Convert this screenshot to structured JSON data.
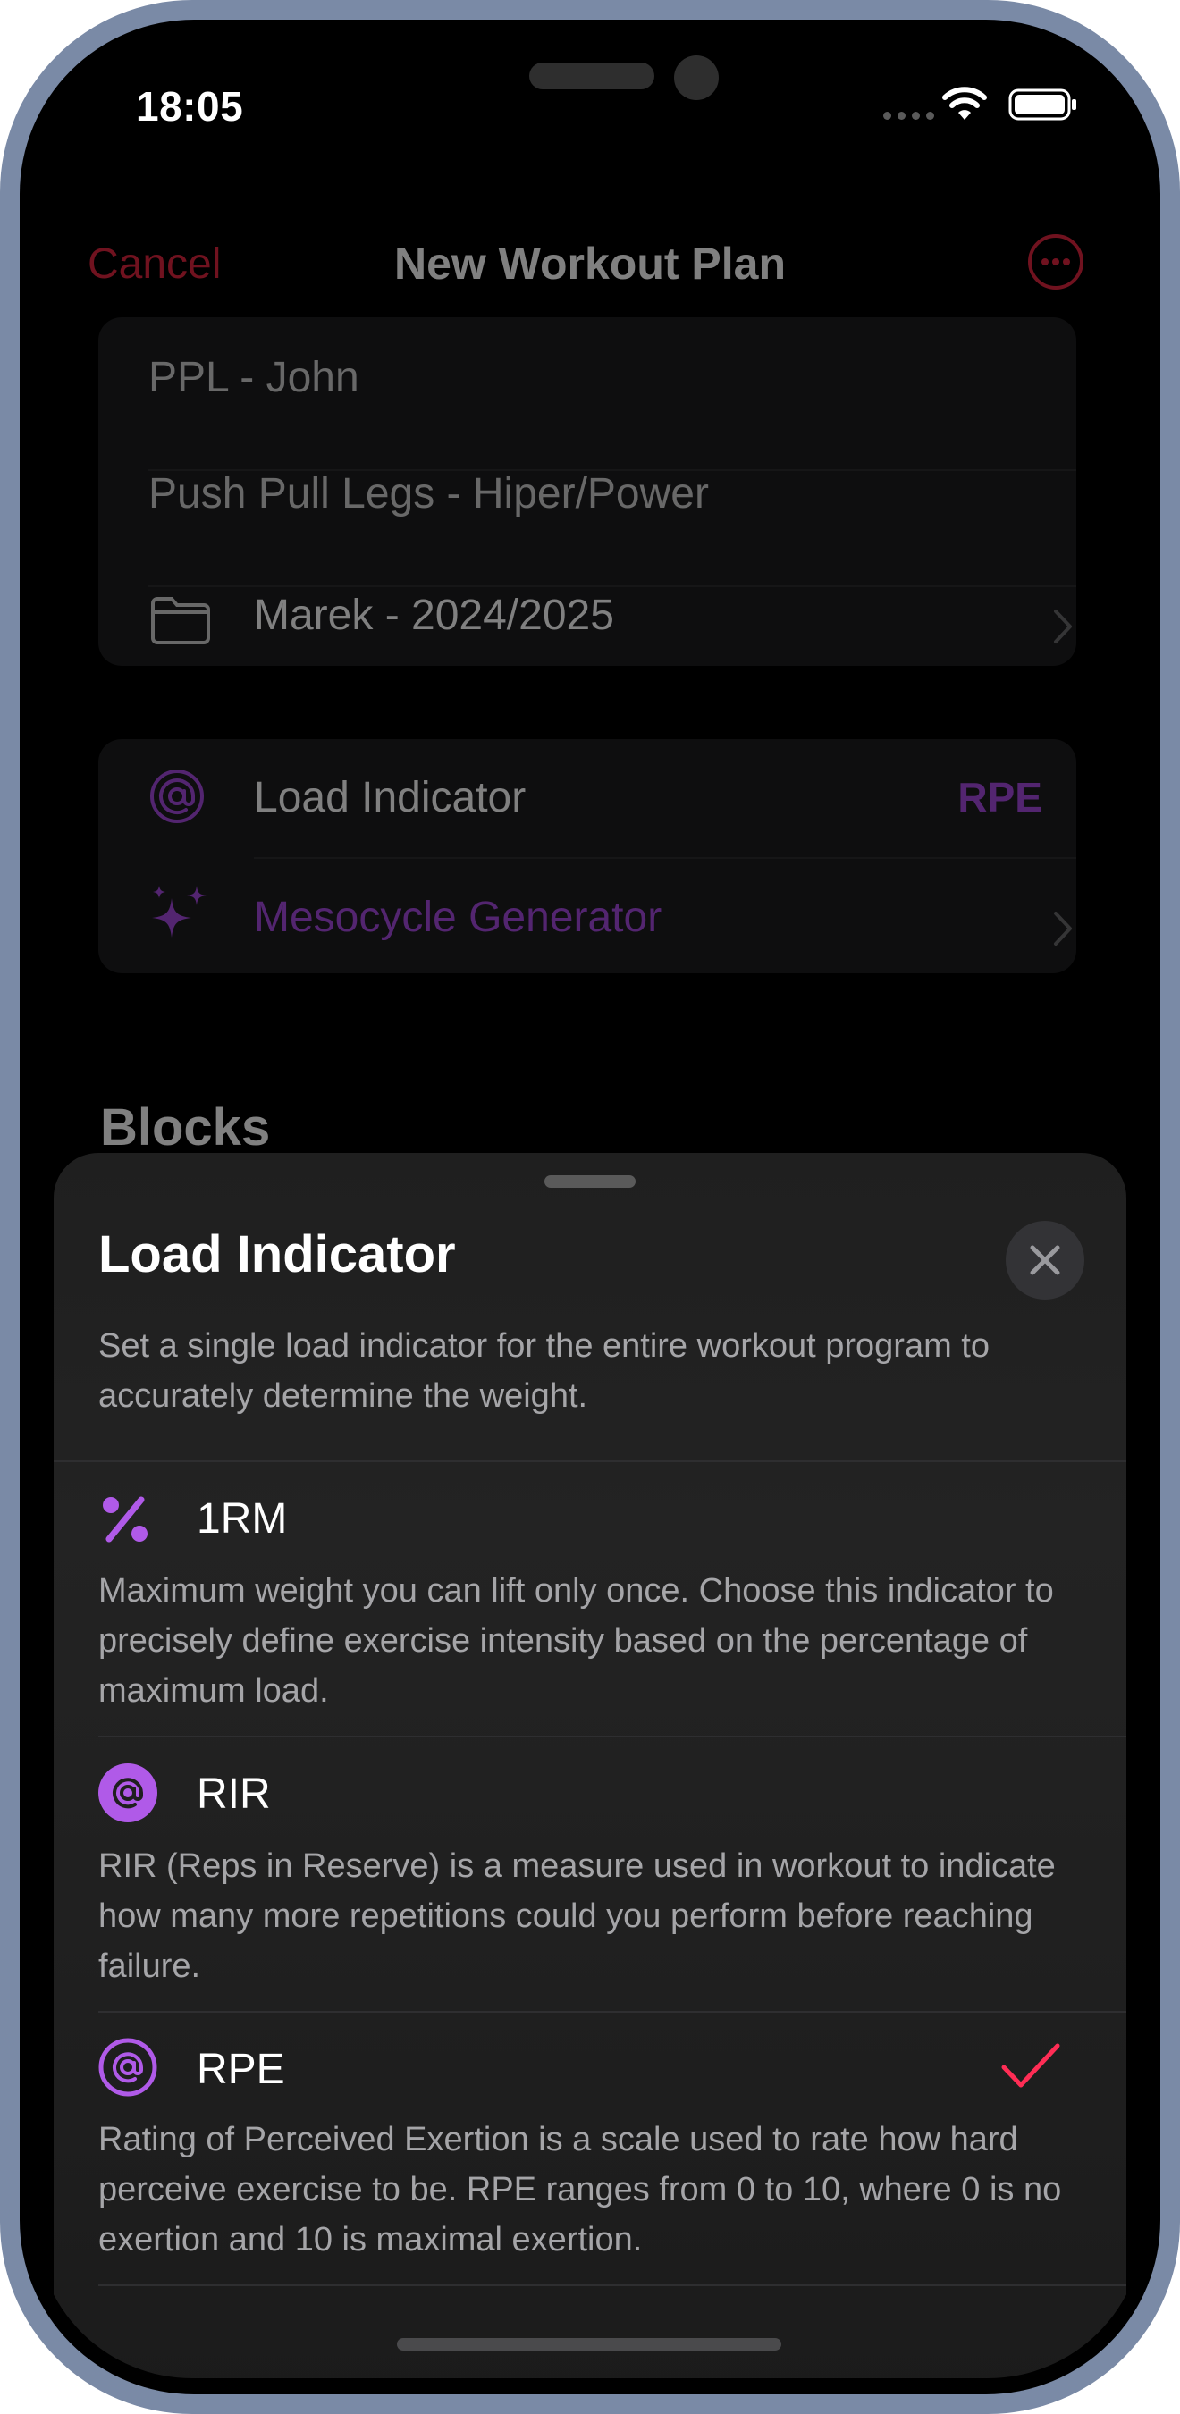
{
  "status_bar": {
    "time": "18:05"
  },
  "nav": {
    "cancel_label": "Cancel",
    "title": "New Workout Plan",
    "more_icon": "ellipsis-circle-icon"
  },
  "plan_card": {
    "name": "PPL - John",
    "description": "Push Pull Legs - Hiper/Power",
    "folder": "Marek - 2024/2025"
  },
  "settings_card": {
    "load_indicator_label": "Load Indicator",
    "load_indicator_value": "RPE",
    "mesocycle_label": "Mesocycle Generator"
  },
  "blocks_title": "Blocks",
  "sheet": {
    "title": "Load Indicator",
    "description": "Set a single load indicator for the entire workout program to accurately determine the weight.",
    "options": [
      {
        "title": "1RM",
        "icon": "percent-icon",
        "description": "Maximum weight you can lift only once. Choose this indicator to precisely define exercise intensity based on the percentage of maximum load.",
        "selected": false
      },
      {
        "title": "RIR",
        "icon": "at-circle-icon",
        "description": "RIR (Reps in Reserve) is a measure used in workout to indicate how many more repetitions could you perform before reaching failure.",
        "selected": false
      },
      {
        "title": "RPE",
        "icon": "at-circle-icon",
        "description": "Rating of Perceived Exertion is a scale used to rate how hard perceive exercise to be. RPE ranges from 0 to 10, where 0 is no exertion and 10 is maximal exertion.",
        "selected": true
      }
    ]
  },
  "colors": {
    "accent_red": "#e0243f",
    "accent_purple": "#a64be0",
    "check_red": "#ff2d55",
    "sheet_bg": "#1f1f1f"
  }
}
